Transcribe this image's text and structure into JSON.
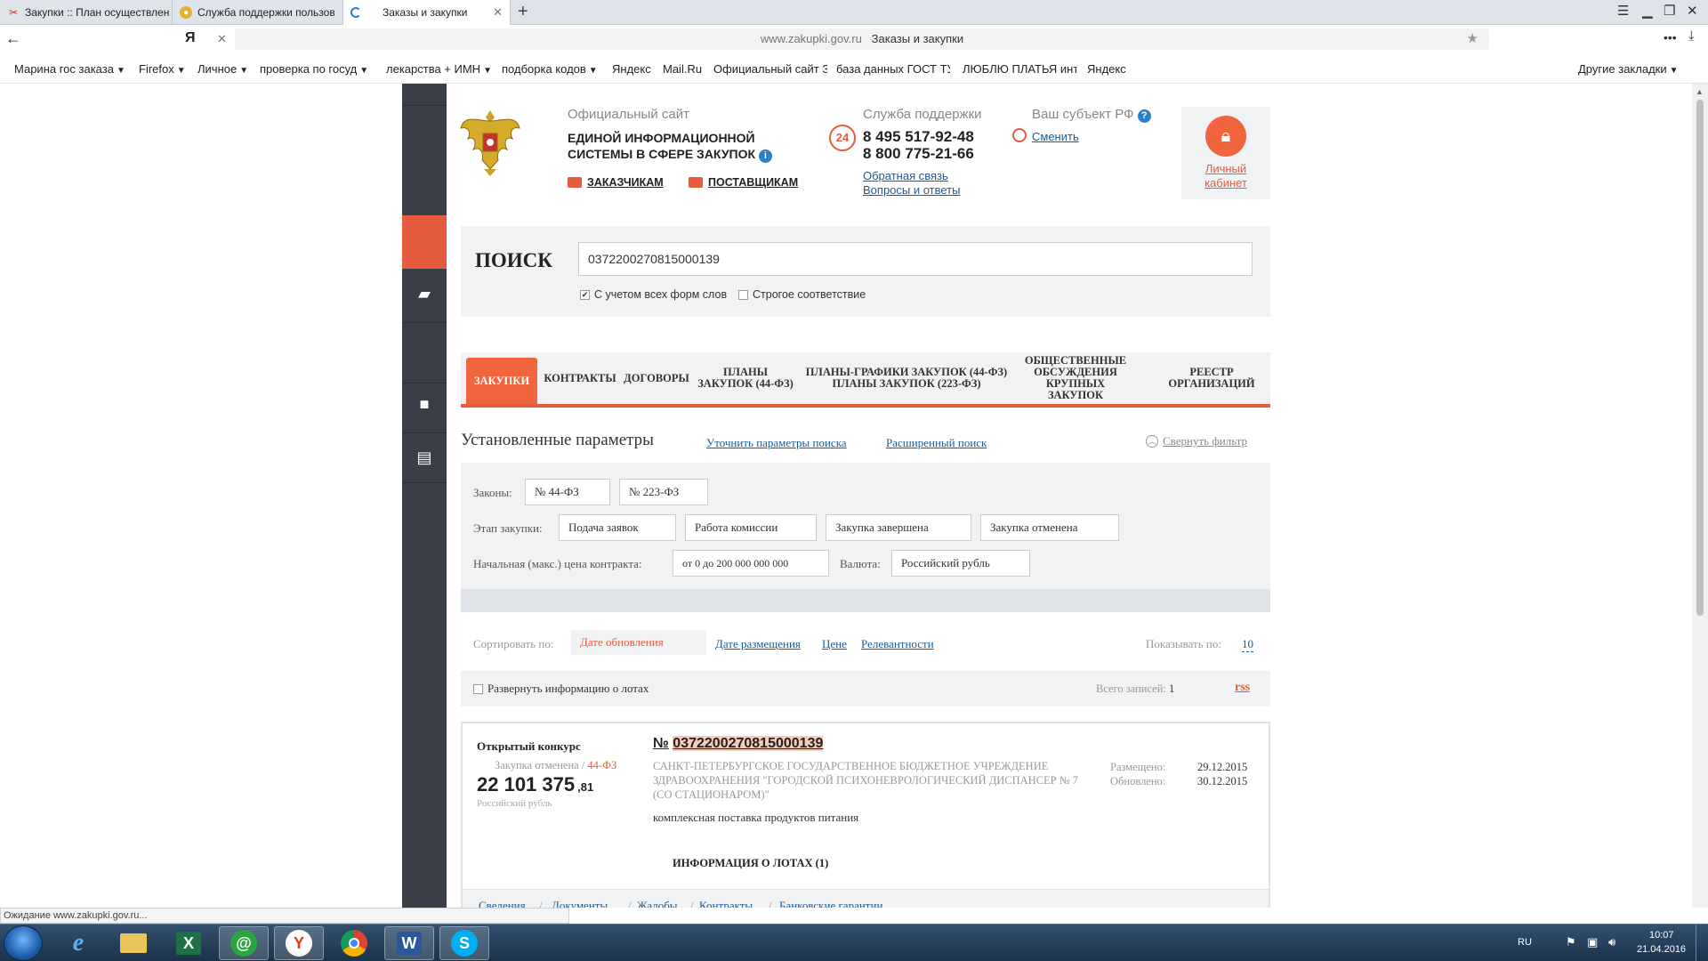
{
  "browser": {
    "tabs": [
      {
        "title": "Закупки :: План осуществлен",
        "active": false
      },
      {
        "title": "Служба поддержки пользов",
        "active": false
      },
      {
        "title": "Заказы и закупки",
        "active": true
      }
    ],
    "address_domain": "www.zakupki.gov.ru",
    "address_title": "Заказы и закупки",
    "bookmarks": [
      "Марина гос заказа",
      "Firefox",
      "Личное",
      "проверка по госуд",
      "лекарства + ИМН",
      "подборка кодов",
      "Яндекс",
      "Mail.Ru",
      "Официальный сайт З",
      "база данных ГОСТ ТУ",
      "ЛЮБЛЮ ПЛАТЬЯ инт",
      "Яндекс"
    ],
    "other_bookmarks": "Другие закладки",
    "status_text": "Ожидание www.zakupki.gov.ru..."
  },
  "header": {
    "official_site": "Официальный сайт",
    "title_line1": "ЕДИНОЙ ИНФОРМАЦИОННОЙ",
    "title_line2": "СИСТЕМЫ В СФЕРЕ ЗАКУПОК",
    "customers": "ЗАКАЗЧИКАМ",
    "suppliers": "ПОСТАВЩИКАМ",
    "support_label": "Служба поддержки",
    "support_badge": "24",
    "phone1": "8 495 517-92-48",
    "phone2": "8 800 775-21-66",
    "feedback": "Обратная связь",
    "faq": "Вопросы и ответы",
    "region_label": "Ваш субъект РФ",
    "region_change": "Сменить",
    "cabinet_line1": "Личный",
    "cabinet_line2": "кабинет"
  },
  "search": {
    "label": "ПОИСК",
    "value": "0372200270815000139",
    "opt_all_forms": "С учетом всех форм слов",
    "opt_strict": "Строгое соответствие"
  },
  "nav_tabs": [
    {
      "line1": "Закупки",
      "line2": "",
      "line3": ""
    },
    {
      "line1": "Контракты",
      "line2": "",
      "line3": ""
    },
    {
      "line1": "Договоры",
      "line2": "",
      "line3": ""
    },
    {
      "line1": "Планы",
      "line2": "закупок (44-ФЗ)",
      "line3": ""
    },
    {
      "line1": "Планы-графики закупок (44-ФЗ)",
      "line2": "Планы закупок (223-ФЗ)",
      "line3": ""
    },
    {
      "line1": "Общественные",
      "line2": "обсуждения",
      "line3": "крупных закупок"
    },
    {
      "line1": "Реестр",
      "line2": "организаций",
      "line3": ""
    }
  ],
  "params": {
    "title": "Установленные параметры",
    "refine": "Уточнить параметры поиска",
    "advanced": "Расширенный поиск",
    "collapse": "Свернуть фильтр"
  },
  "filter": {
    "laws_label": "Законы:",
    "law1": "№ 44-ФЗ",
    "law2": "№ 223-ФЗ",
    "stage_label": "Этап закупки:",
    "stage1": "Подача заявок",
    "stage2": "Работа комиссии",
    "stage3": "Закупка завершена",
    "stage4": "Закупка отменена",
    "price_label": "Начальная (макс.) цена контракта:",
    "price_value": "от 0 до 200 000 000 000",
    "currency_label": "Валюта:",
    "currency_value": "Российский рубль"
  },
  "sort": {
    "label": "Сортировать по:",
    "active": "Дате обновления",
    "opt_posted": "Дате размещения",
    "opt_price": "Цене",
    "opt_relevance": "Релевантности",
    "show_label": "Показывать по:",
    "show_value": "10"
  },
  "expand": {
    "label": "Развернуть информацию о лотах",
    "total_label": "Всего записей:",
    "total_value": "1",
    "rss": "rss"
  },
  "result": {
    "type": "Открытый конкурс",
    "status": "Закупка отменена",
    "law": "44-ФЗ",
    "price_main": "22 101 375",
    "price_cents": ",81",
    "currency": "Российский рубль",
    "number_prefix": "№",
    "number": "0372200270815000139",
    "org_line1": "САНКТ-ПЕТЕРБУРГСКОЕ ГОСУДАРСТВЕННОЕ БЮДЖЕТНОЕ УЧРЕЖДЕНИЕ",
    "org_line2": "ЗДРАВООХРАНЕНИЯ \"ГОРОДСКОЙ ПСИХОНЕВРОЛОГИЧЕСКИЙ ДИСПАНСЕР № 7",
    "org_line3": "(СО СТАЦИОНАРОМ)\"",
    "object": "комплексная поставка продуктов питания",
    "posted_label": "Размещено:",
    "posted_date": "29.12.2015",
    "updated_label": "Обновлено:",
    "updated_date": "30.12.2015",
    "lots": "ИНФОРМАЦИЯ О ЛОТАХ (1)",
    "links": [
      "Сведения",
      "Документы",
      "Жалобы",
      "Контракты",
      "Банковские гарантии"
    ]
  },
  "taskbar": {
    "lang": "RU",
    "time": "10:07",
    "date": "21.04.2016"
  },
  "colors": {
    "accent": "#e65b3e",
    "link": "#1a5a9a",
    "nav_dark": "#3a3f47"
  }
}
